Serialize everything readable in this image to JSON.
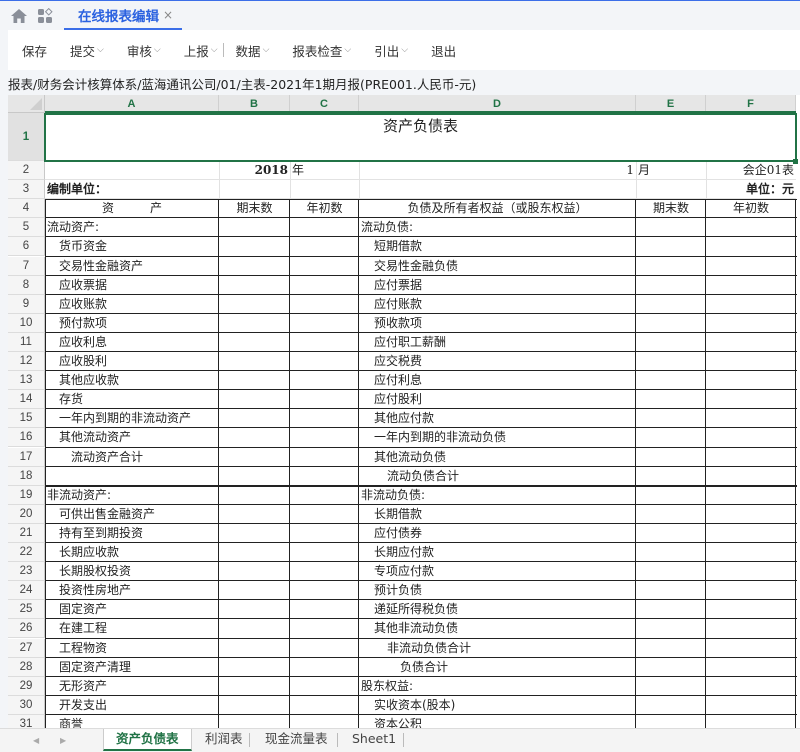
{
  "tabbar": {
    "home_icon": "home-icon",
    "apps_icon": "apps-grid-icon",
    "active_tab": "在线报表编辑",
    "close_glyph": "×"
  },
  "toolbar": {
    "buttons": [
      {
        "label": "保存",
        "dropdown": false
      },
      {
        "label": "提交",
        "dropdown": true
      },
      {
        "label": "审核",
        "dropdown": true
      },
      {
        "label": "上报",
        "dropdown": true
      },
      {
        "label": "数据",
        "dropdown": true
      },
      {
        "label": "报表检查",
        "dropdown": true
      },
      {
        "label": "引出",
        "dropdown": true
      },
      {
        "label": "退出",
        "dropdown": false
      }
    ],
    "chevron": "⌵"
  },
  "breadcrumb": "报表/财务会计核算体系/蓝海通讯公司/01/主表-2021年1期月报(PRE001.人民币-元)",
  "sheet": {
    "columns": [
      "A",
      "B",
      "C",
      "D",
      "E",
      "F"
    ],
    "title": "资产负债表",
    "row2": {
      "year_value": "2018",
      "year_label": "年",
      "month_value": "1",
      "month_label": "月",
      "form_no": "会企01表"
    },
    "row3": {
      "compiler_label": "编制单位：",
      "unit_label": "单位：元"
    },
    "header": {
      "asset": "资　　　产",
      "end": "期末数",
      "begin": "年初数",
      "liab": "负债及所有者权益（或股东权益）",
      "end2": "期末数",
      "begin2": "年初数"
    },
    "rows": [
      {
        "n": "5",
        "a": "流动资产:",
        "ai": 0,
        "d": "流动负债:",
        "di": 0
      },
      {
        "n": "6",
        "a": "货币资金",
        "ai": 1,
        "d": "短期借款",
        "di": 1
      },
      {
        "n": "7",
        "a": "交易性金融资产",
        "ai": 1,
        "d": "交易性金融负债",
        "di": 1
      },
      {
        "n": "8",
        "a": "应收票据",
        "ai": 1,
        "d": "应付票据",
        "di": 1
      },
      {
        "n": "9",
        "a": "应收账款",
        "ai": 1,
        "d": "应付账款",
        "di": 1
      },
      {
        "n": "10",
        "a": "预付款项",
        "ai": 1,
        "d": "预收款项",
        "di": 1
      },
      {
        "n": "11",
        "a": "应收利息",
        "ai": 1,
        "d": "应付职工薪酬",
        "di": 1
      },
      {
        "n": "12",
        "a": "应收股利",
        "ai": 1,
        "d": "应交税费",
        "di": 1
      },
      {
        "n": "13",
        "a": "其他应收款",
        "ai": 1,
        "d": "应付利息",
        "di": 1
      },
      {
        "n": "14",
        "a": "存货",
        "ai": 1,
        "d": "应付股利",
        "di": 1
      },
      {
        "n": "15",
        "a": "一年内到期的非流动资产",
        "ai": 1,
        "d": "其他应付款",
        "di": 1
      },
      {
        "n": "16",
        "a": "其他流动资产",
        "ai": 1,
        "d": "一年内到期的非流动负债",
        "di": 1
      },
      {
        "n": "17",
        "a": "流动资产合计",
        "ai": 2,
        "d": "其他流动负债",
        "di": 1
      },
      {
        "n": "18",
        "a": "",
        "ai": 0,
        "d": "流动负债合计",
        "di": 2
      },
      {
        "n": "19",
        "a": "非流动资产:",
        "ai": 0,
        "d": "非流动负债:",
        "di": 0
      },
      {
        "n": "20",
        "a": "可供出售金融资产",
        "ai": 1,
        "d": "长期借款",
        "di": 1
      },
      {
        "n": "21",
        "a": "持有至到期投资",
        "ai": 1,
        "d": "应付债券",
        "di": 1
      },
      {
        "n": "22",
        "a": "长期应收款",
        "ai": 1,
        "d": "长期应付款",
        "di": 1
      },
      {
        "n": "23",
        "a": "长期股权投资",
        "ai": 1,
        "d": "专项应付款",
        "di": 1
      },
      {
        "n": "24",
        "a": "投资性房地产",
        "ai": 1,
        "d": "预计负债",
        "di": 1
      },
      {
        "n": "25",
        "a": "固定资产",
        "ai": 1,
        "d": "递延所得税负债",
        "di": 1
      },
      {
        "n": "26",
        "a": "在建工程",
        "ai": 1,
        "d": "其他非流动负债",
        "di": 1
      },
      {
        "n": "27",
        "a": "工程物资",
        "ai": 1,
        "d": "非流动负债合计",
        "di": 2
      },
      {
        "n": "28",
        "a": "固定资产清理",
        "ai": 1,
        "d": "负债合计",
        "di": 3
      },
      {
        "n": "29",
        "a": "无形资产",
        "ai": 1,
        "d": "股东权益:",
        "di": 0
      },
      {
        "n": "30",
        "a": "开发支出",
        "ai": 1,
        "d": "实收资本(股本)",
        "di": 1
      },
      {
        "n": "31",
        "a": "商誉",
        "ai": 1,
        "d": "资本公积",
        "di": 1
      }
    ]
  },
  "sheet_tabs": {
    "prev": "◀",
    "next": "▶",
    "tabs": [
      "资产负债表",
      "利润表",
      "现金流量表",
      "Sheet1"
    ],
    "active": 0
  },
  "colors": {
    "accent": "#2b62e0",
    "excel_green": "#217346"
  }
}
